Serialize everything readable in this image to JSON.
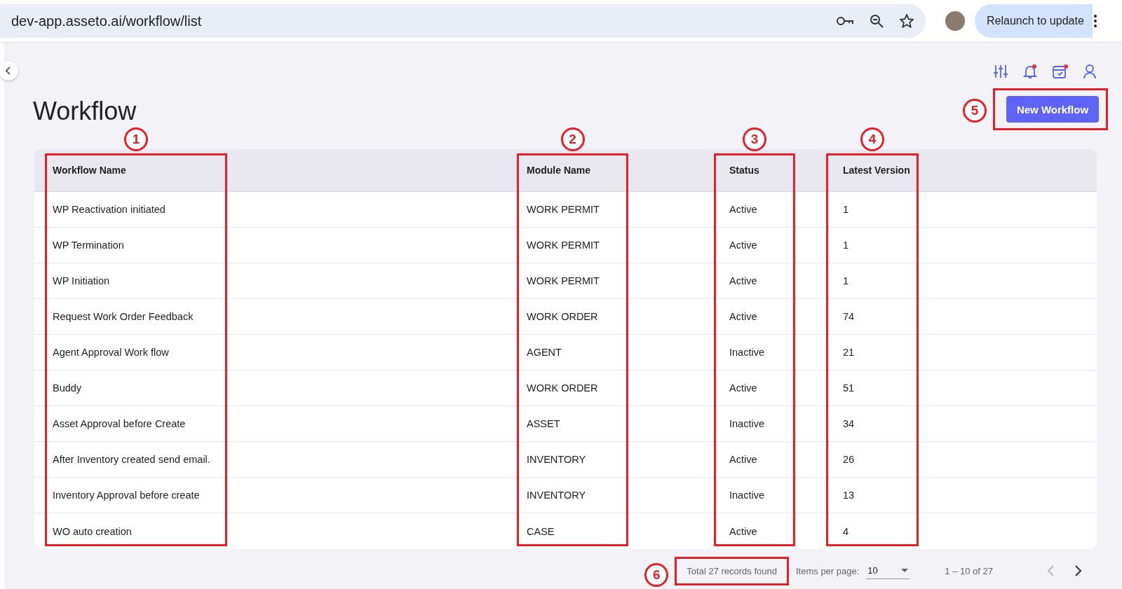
{
  "browser": {
    "url": "dev-app.asseto.ai/workflow/list",
    "relaunch_button": "Relaunch to update"
  },
  "page": {
    "title": "Workflow",
    "new_button": {
      "label": "New Workflow",
      "callout": "5"
    }
  },
  "table": {
    "columns": [
      {
        "label": "Workflow Name",
        "callout": "1"
      },
      {
        "label": "Module Name",
        "callout": "2"
      },
      {
        "label": "Status",
        "callout": "3"
      },
      {
        "label": "Latest Version",
        "callout": "4"
      }
    ],
    "rows": [
      [
        "WP Reactivation initiated",
        "WORK PERMIT",
        "Active",
        "1"
      ],
      [
        "WP Termination",
        "WORK PERMIT",
        "Active",
        "1"
      ],
      [
        "WP Initiation",
        "WORK PERMIT",
        "Active",
        "1"
      ],
      [
        "Request Work Order Feedback",
        "WORK ORDER",
        "Active",
        "74"
      ],
      [
        "Agent Approval Work flow",
        "AGENT",
        "Inactive",
        "21"
      ],
      [
        "Buddy",
        "WORK ORDER",
        "Active",
        "51"
      ],
      [
        "Asset Approval before Create",
        "ASSET",
        "Inactive",
        "34"
      ],
      [
        "After Inventory created send email.",
        "INVENTORY",
        "Active",
        "26"
      ],
      [
        "Inventory Approval before create",
        "INVENTORY",
        "Inactive",
        "13"
      ],
      [
        "WO auto creation",
        "CASE",
        "Active",
        "4"
      ]
    ]
  },
  "paginator": {
    "total": "Total 27 records found",
    "total_callout": "6",
    "items_per_page_label": "Items per page:",
    "items_per_page": "10",
    "range": "1 – 10 of 27",
    "previous_disabled": true,
    "next_disabled": false
  }
}
